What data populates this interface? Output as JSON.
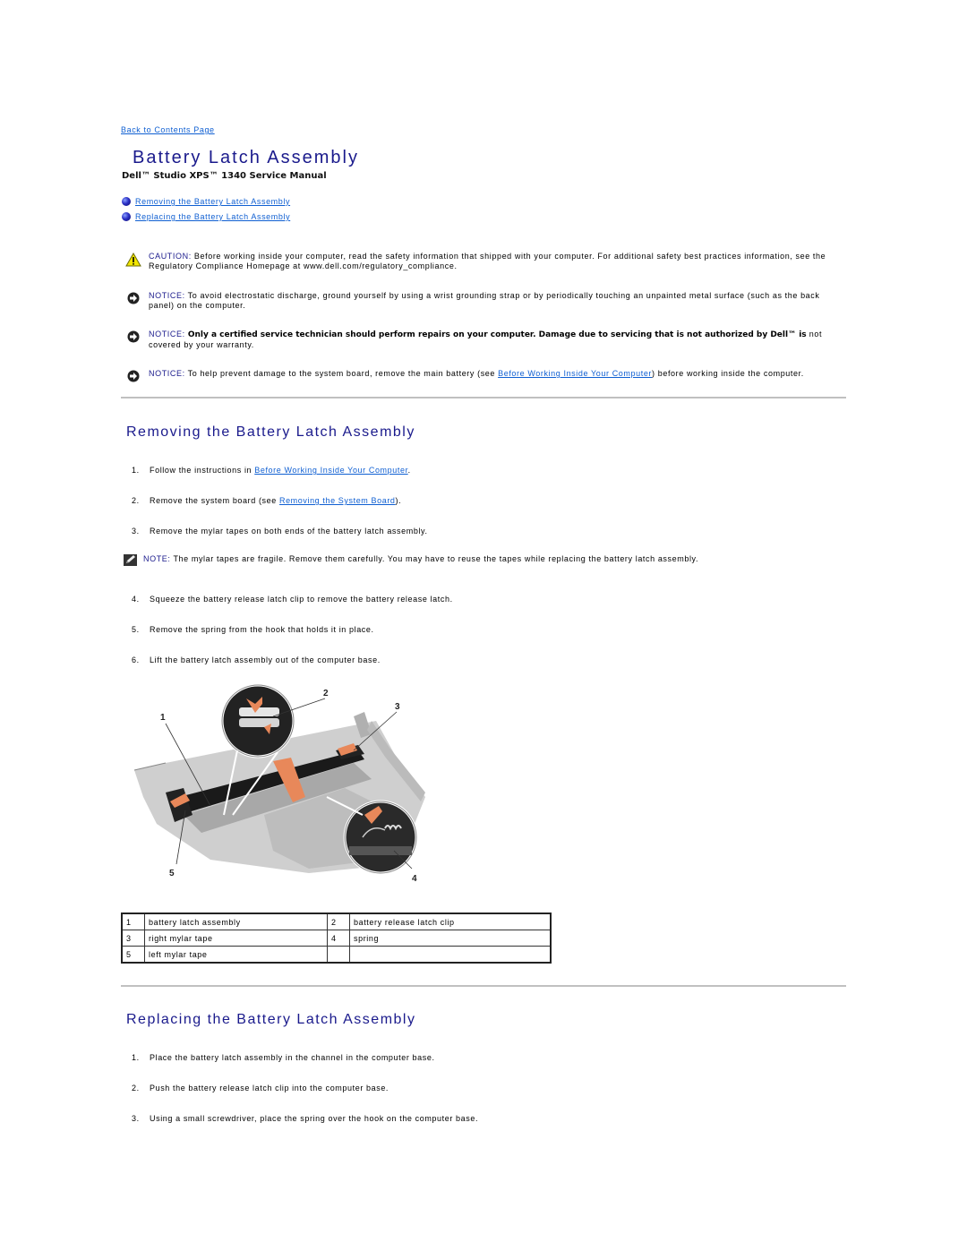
{
  "nav": {
    "back_link": "Back to Contents Page"
  },
  "header": {
    "title": "Battery Latch Assembly",
    "subtitle": "Dell™ Studio XPS™ 1340 Service Manual"
  },
  "toc": [
    {
      "label": "Removing the Battery Latch Assembly",
      "icon": "blue-bullet-icon"
    },
    {
      "label": "Replacing the Battery Latch Assembly",
      "icon": "blue-bullet-icon"
    }
  ],
  "admonitions": [
    {
      "type": "caution",
      "icon": "warning-triangle-icon",
      "label": "CAUTION:",
      "text": " Before working inside your computer, read the safety information that shipped with your computer. For additional safety best practices information, see the Regulatory Compliance Homepage at www.dell.com/regulatory_compliance."
    },
    {
      "type": "notice",
      "icon": "notice-arrow-icon",
      "label": "NOTICE:",
      "text": " To avoid electrostatic discharge, ground yourself by using a wrist grounding strap or by periodically touching an unpainted metal surface (such as the back panel) on the computer."
    },
    {
      "type": "notice",
      "icon": "notice-arrow-icon",
      "label": "NOTICE:",
      "bold_text": " Only a certified service technician should perform repairs on your computer. Damage due to servicing that is not authorized by Dell™ is",
      "text": " not covered by your warranty."
    },
    {
      "type": "notice",
      "icon": "notice-arrow-icon",
      "label": "NOTICE:",
      "text_before": " To help prevent damage to the system board, remove the main battery (see ",
      "link": "Before Working Inside Your Computer",
      "text_after": ") before working inside the computer."
    }
  ],
  "removing": {
    "title": "Removing the Battery Latch Assembly",
    "steps": [
      {
        "num": "1.",
        "before": "Follow the instructions in ",
        "link": "Before Working Inside Your Computer",
        "after": "."
      },
      {
        "num": "2.",
        "before": "Remove the system board (see ",
        "link": "Removing the System Board",
        "after": ")."
      },
      {
        "num": "3.",
        "before": "Remove the mylar tapes on both ends of the battery latch assembly."
      }
    ],
    "note": {
      "icon": "note-pencil-icon",
      "label": "NOTE:",
      "text": " The mylar tapes are fragile. Remove them carefully. You may have to reuse the tapes while replacing the battery latch assembly."
    },
    "steps_after_note": [
      {
        "num": "4.",
        "text": "Squeeze the battery release latch clip to remove the battery release latch."
      },
      {
        "num": "5.",
        "text": "Remove the spring from the hook that holds it in place."
      },
      {
        "num": "6.",
        "text": "Lift the battery latch assembly out of the computer base."
      }
    ],
    "figure": {
      "callouts": [
        "1",
        "2",
        "3",
        "4",
        "5"
      ]
    },
    "callout_table": [
      [
        {
          "n": "1",
          "d": "battery latch assembly"
        },
        {
          "n": "2",
          "d": "battery release latch clip"
        }
      ],
      [
        {
          "n": "3",
          "d": "right mylar tape"
        },
        {
          "n": "4",
          "d": "spring"
        }
      ],
      [
        {
          "n": "5",
          "d": "left mylar tape"
        },
        {
          "n": "",
          "d": ""
        }
      ]
    ]
  },
  "replacing": {
    "title": "Replacing the Battery Latch Assembly",
    "steps": [
      {
        "num": "1.",
        "text": "Place the battery latch assembly in the channel in the computer base."
      },
      {
        "num": "2.",
        "text": "Push the battery release latch clip into the computer base."
      },
      {
        "num": "3.",
        "text": "Using a small screwdriver, place the spring over the hook on the computer base."
      }
    ]
  }
}
